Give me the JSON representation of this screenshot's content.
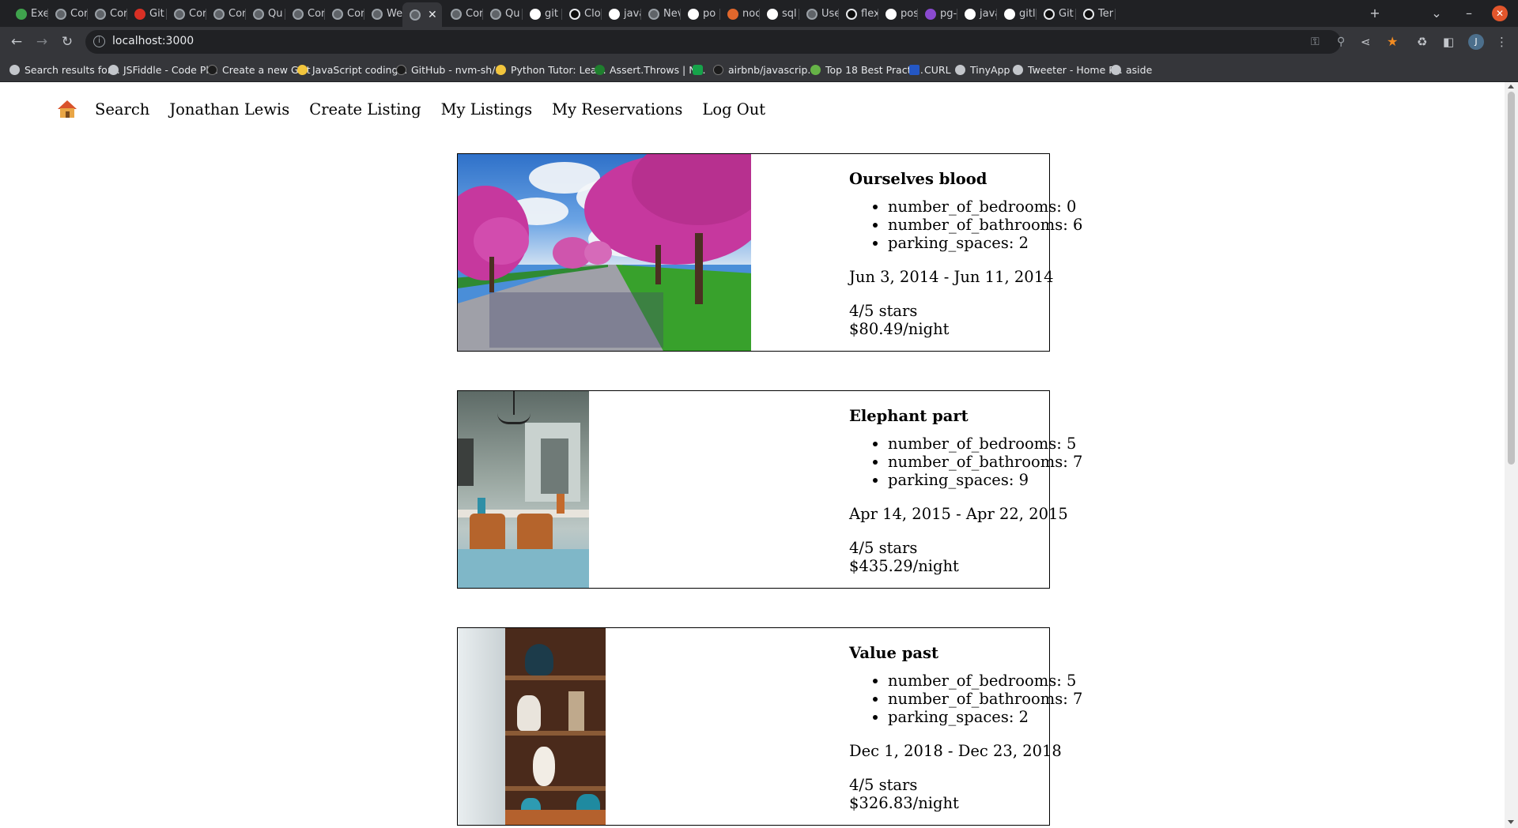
{
  "browser": {
    "tabs": [
      {
        "label": "Exe",
        "fav": "green"
      },
      {
        "label": "Cor",
        "fav": "grey"
      },
      {
        "label": "Cor",
        "fav": "grey"
      },
      {
        "label": "Git",
        "fav": "red"
      },
      {
        "label": "Cor",
        "fav": "grey"
      },
      {
        "label": "Cor",
        "fav": "grey"
      },
      {
        "label": "Qu",
        "fav": "grey"
      },
      {
        "label": "Cor",
        "fav": "grey"
      },
      {
        "label": "Cor",
        "fav": "grey"
      },
      {
        "label": "We",
        "fav": "grey"
      },
      {
        "label": "",
        "fav": "grey",
        "active": true
      },
      {
        "label": "Cor",
        "fav": "grey"
      },
      {
        "label": "Qu",
        "fav": "grey"
      },
      {
        "label": "git",
        "fav": "g"
      },
      {
        "label": "Clo",
        "fav": "gh"
      },
      {
        "label": "java",
        "fav": "g"
      },
      {
        "label": "Nev",
        "fav": "grey"
      },
      {
        "label": "po",
        "fav": "g"
      },
      {
        "label": "noc",
        "fav": "orange"
      },
      {
        "label": "sql",
        "fav": "g"
      },
      {
        "label": "Use",
        "fav": "grey"
      },
      {
        "label": "flex",
        "fav": "gh"
      },
      {
        "label": "pos",
        "fav": "g"
      },
      {
        "label": "pg-",
        "fav": "purple"
      },
      {
        "label": "java",
        "fav": "g"
      },
      {
        "label": "gitl",
        "fav": "g"
      },
      {
        "label": "Git",
        "fav": "gh"
      },
      {
        "label": "Ter",
        "fav": "gh"
      }
    ],
    "url": "localhost:3000",
    "profile_initial": "J",
    "bookmarks": [
      {
        "label": "Search results for...",
        "fav": "globe"
      },
      {
        "label": "JSFiddle - Code Pl...",
        "fav": "globe"
      },
      {
        "label": "Create a new Gist",
        "fav": "gh"
      },
      {
        "label": "JavaScript coding...",
        "fav": "py"
      },
      {
        "label": "GitHub - nvm-sh/...",
        "fav": "gh"
      },
      {
        "label": "Python Tutor: Lea...",
        "fav": "py"
      },
      {
        "label": "Assert.Throws | N...",
        "fav": "nm"
      },
      {
        "label": "",
        "fav": "shield"
      },
      {
        "label": "airbnb/javascrip...",
        "fav": "gh"
      },
      {
        "label": "Top 18 Best Practi...",
        "fav": "node"
      },
      {
        "label": "CURL",
        "fav": "curl"
      },
      {
        "label": "TinyApp",
        "fav": "globe"
      },
      {
        "label": "Tweeter - Home P...",
        "fav": "globe"
      },
      {
        "label": "aside",
        "fav": "globe"
      }
    ]
  },
  "nav": {
    "home_icon": "house-emoji-icon",
    "links": [
      "Search",
      "Jonathan Lewis",
      "Create Listing",
      "My Listings",
      "My Reservations",
      "Log Out"
    ]
  },
  "listings": [
    {
      "title": "Ourselves blood",
      "features": [
        "number_of_bedrooms: 0",
        "number_of_bathrooms: 6",
        "parking_spaces: 2"
      ],
      "dates": "Jun 3, 2014 - Jun 11, 2014",
      "rating": "4/5 stars",
      "price": "$80.49/night",
      "photo": "street with pink blossoming trees"
    },
    {
      "title": "Elephant part",
      "features": [
        "number_of_bedrooms: 5",
        "number_of_bathrooms: 7",
        "parking_spaces: 9"
      ],
      "dates": "Apr 14, 2015 - Apr 22, 2015",
      "rating": "4/5 stars",
      "price": "$435.29/night",
      "photo": "dining room with chandelier"
    },
    {
      "title": "Value past",
      "features": [
        "number_of_bedrooms: 5",
        "number_of_bathrooms: 7",
        "parking_spaces: 2"
      ],
      "dates": "Dec 1, 2018 - Dec 23, 2018",
      "rating": "4/5 stars",
      "price": "$326.83/night",
      "photo": "wooden shelf with vases"
    }
  ]
}
